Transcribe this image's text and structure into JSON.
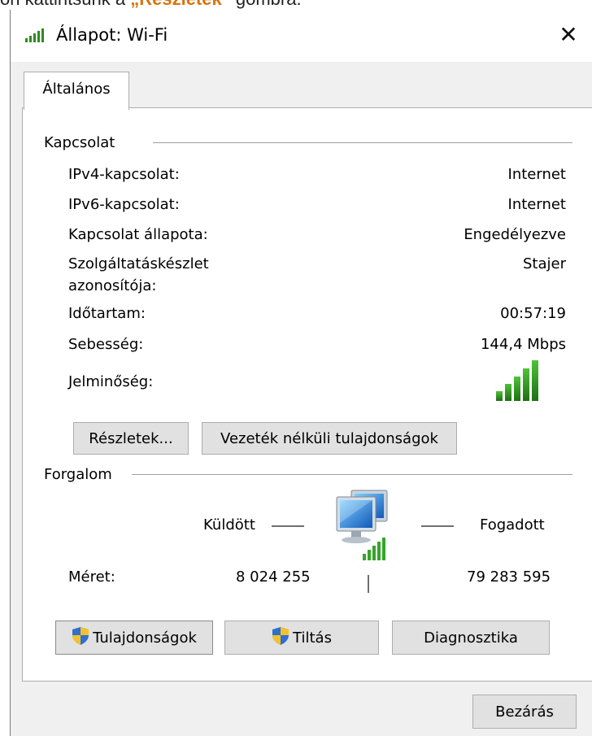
{
  "caption": {
    "prefix": "on kattintsunk a ",
    "highlight": "„Részletek”",
    "suffix": " gombra."
  },
  "window": {
    "title": "Állapot: Wi-Fi",
    "close_glyph": "✕"
  },
  "tabs": [
    {
      "label": "Általános",
      "active": true
    }
  ],
  "connection": {
    "group_label": "Kapcsolat",
    "rows": [
      {
        "label": "IPv4-kapcsolat:",
        "value": "Internet"
      },
      {
        "label": "IPv6-kapcsolat:",
        "value": "Internet"
      },
      {
        "label": "Kapcsolat állapota:",
        "value": "Engedélyezve"
      },
      {
        "label": "Szolgáltatáskészlet",
        "label2": "azonosítója:",
        "value": "Stajer"
      },
      {
        "label": "Időtartam:",
        "value": "00:57:19"
      },
      {
        "label": "Sebesség:",
        "value": "144,4 Mbps"
      },
      {
        "label": "Jelminőség:",
        "signal_bars": 5
      }
    ],
    "details_button": "Részletek...",
    "wireless_props_button": "Vezeték nélküli tulajdonságok"
  },
  "activity": {
    "group_label": "Forgalom",
    "sent_label": "Küldött",
    "received_label": "Fogadott",
    "size_label": "Méret:",
    "sent_bytes": "8 024 255",
    "received_bytes": "79 283 595"
  },
  "footer_buttons": {
    "properties": "Tulajdonságok",
    "disable": "Tiltás",
    "diagnose": "Diagnosztika"
  },
  "close_button": "Bezárás",
  "colors": {
    "signal_green": "#2e8b1f",
    "shield_blue": "#2f6fd0",
    "shield_yellow": "#f3c12a",
    "caption_highlight": "#d9730b"
  }
}
